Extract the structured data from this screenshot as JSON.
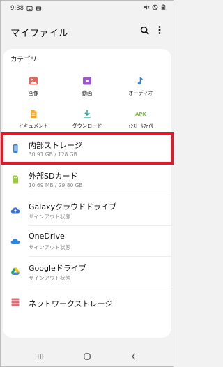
{
  "status_bar": {
    "time": "9:38",
    "left_icons": [
      "image-icon",
      "notification-icon"
    ],
    "right_icons": [
      "mute-icon",
      "dnd-icon",
      "battery-icon"
    ]
  },
  "header": {
    "title": "マイファイル",
    "actions": [
      "search-icon",
      "more-icon"
    ]
  },
  "categories": {
    "heading": "カテゴリ",
    "items": [
      {
        "label": "画像",
        "icon": "image-icon",
        "color": "#e8655a"
      },
      {
        "label": "動画",
        "icon": "video-icon",
        "color": "#9b57d3"
      },
      {
        "label": "オーディオ",
        "icon": "audio-icon",
        "color": "#3b82d6"
      },
      {
        "label": "ドキュメント",
        "icon": "document-icon",
        "color": "#f0a830"
      },
      {
        "label": "ダウンロード",
        "icon": "download-icon",
        "color": "#2aa7a0"
      },
      {
        "label": "ｲﾝｽﾄｰﾙﾌｧｲﾙ",
        "icon": "apk-icon",
        "icon_text": "APK",
        "color": "#7bc142"
      }
    ]
  },
  "storage": {
    "items": [
      {
        "title": "内部ストレージ",
        "subtitle": "30.91 GB / 128 GB",
        "icon": "phone-icon",
        "color": "#3b82d6",
        "selected": true
      },
      {
        "title": "外部SDカード",
        "subtitle": "10.69 MB / 29.80 GB",
        "icon": "sd-card-icon",
        "color": "#9ccc3c"
      },
      {
        "title": "Galaxyクラウドドライブ",
        "subtitle": "サインアウト状態",
        "icon": "galaxy-cloud-icon",
        "color": "#3b6fd6"
      },
      {
        "title": "OneDrive",
        "subtitle": "サインアウト状態",
        "icon": "onedrive-icon",
        "color": "#2b8ae0"
      },
      {
        "title": "Googleドライブ",
        "subtitle": "サインアウト状態",
        "icon": "google-drive-icon",
        "color": "#f4c20d"
      },
      {
        "title": "ネットワークストレージ",
        "subtitle": "",
        "icon": "network-storage-icon",
        "color": "#e26b78"
      }
    ]
  },
  "nav_bar": {
    "buttons": [
      "recents-icon",
      "home-icon",
      "back-icon"
    ]
  },
  "colors": {
    "background": "#f2f2f2",
    "card": "#ffffff",
    "highlight": "#e0192b"
  }
}
